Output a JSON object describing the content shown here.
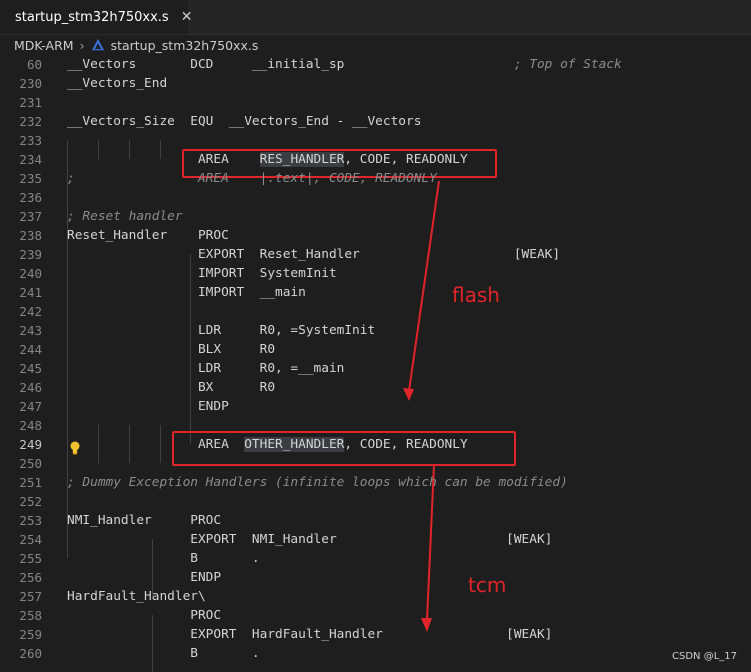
{
  "tab": {
    "label": "startup_stm32h750xx.s",
    "close": "✕"
  },
  "breadcrumb": {
    "folder": "MDK-ARM",
    "sep": "›",
    "file": "startup_stm32h750xx.s"
  },
  "lines": [
    {
      "n": "60",
      "t": "__Vectors       DCD     __initial_sp                      ",
      "c": "; Top of Stack"
    },
    {
      "n": "230",
      "t": "__Vectors_End"
    },
    {
      "n": "231",
      "t": ""
    },
    {
      "n": "232",
      "t": "__Vectors_Size  EQU  __Vectors_End - __Vectors"
    },
    {
      "n": "233",
      "t": ""
    },
    {
      "n": "234",
      "t": "                 AREA    ",
      "s": "RES_HANDLER",
      "r": ", CODE, READONLY"
    },
    {
      "n": "235",
      "t": "",
      "c": ";                AREA    |.text|, CODE, READONLY"
    },
    {
      "n": "236",
      "t": ""
    },
    {
      "n": "237",
      "t": "",
      "c": "; Reset handler"
    },
    {
      "n": "238",
      "t": "Reset_Handler    PROC"
    },
    {
      "n": "239",
      "t": "                 EXPORT  Reset_Handler                    [WEAK]"
    },
    {
      "n": "240",
      "t": "                 IMPORT  SystemInit"
    },
    {
      "n": "241",
      "t": "                 IMPORT  __main"
    },
    {
      "n": "242",
      "t": ""
    },
    {
      "n": "243",
      "t": "                 LDR     R0, =SystemInit"
    },
    {
      "n": "244",
      "t": "                 BLX     R0"
    },
    {
      "n": "245",
      "t": "                 LDR     R0, =__main"
    },
    {
      "n": "246",
      "t": "                 BX      R0"
    },
    {
      "n": "247",
      "t": "                 ENDP"
    },
    {
      "n": "248",
      "t": ""
    },
    {
      "n": "249",
      "t": "                 AREA  ",
      "s": "OTHER_HANDLER",
      "r": ", CODE, READONLY"
    },
    {
      "n": "250",
      "t": ""
    },
    {
      "n": "251",
      "t": "",
      "c": "; Dummy Exception Handlers (infinite loops which can be modified)"
    },
    {
      "n": "252",
      "t": ""
    },
    {
      "n": "253",
      "t": "NMI_Handler     PROC"
    },
    {
      "n": "254",
      "t": "                EXPORT  NMI_Handler                      [WEAK]"
    },
    {
      "n": "255",
      "t": "                B       ."
    },
    {
      "n": "256",
      "t": "                ENDP"
    },
    {
      "n": "257",
      "t": "HardFault_Handler\\"
    },
    {
      "n": "258",
      "t": "                PROC"
    },
    {
      "n": "259",
      "t": "                EXPORT  HardFault_Handler                [WEAK]"
    },
    {
      "n": "260",
      "t": "                B       ."
    }
  ],
  "active_line": "249",
  "annotations": {
    "flash": "flash",
    "tcm": "tcm"
  },
  "watermark": "CSDN @L_17",
  "colors": {
    "background": "#1e1e1e",
    "annotation": "#e0252a",
    "line_number": "#858585"
  },
  "icons": {
    "tab": "keil-triangle-icon",
    "bulb": "lightbulb-icon"
  }
}
